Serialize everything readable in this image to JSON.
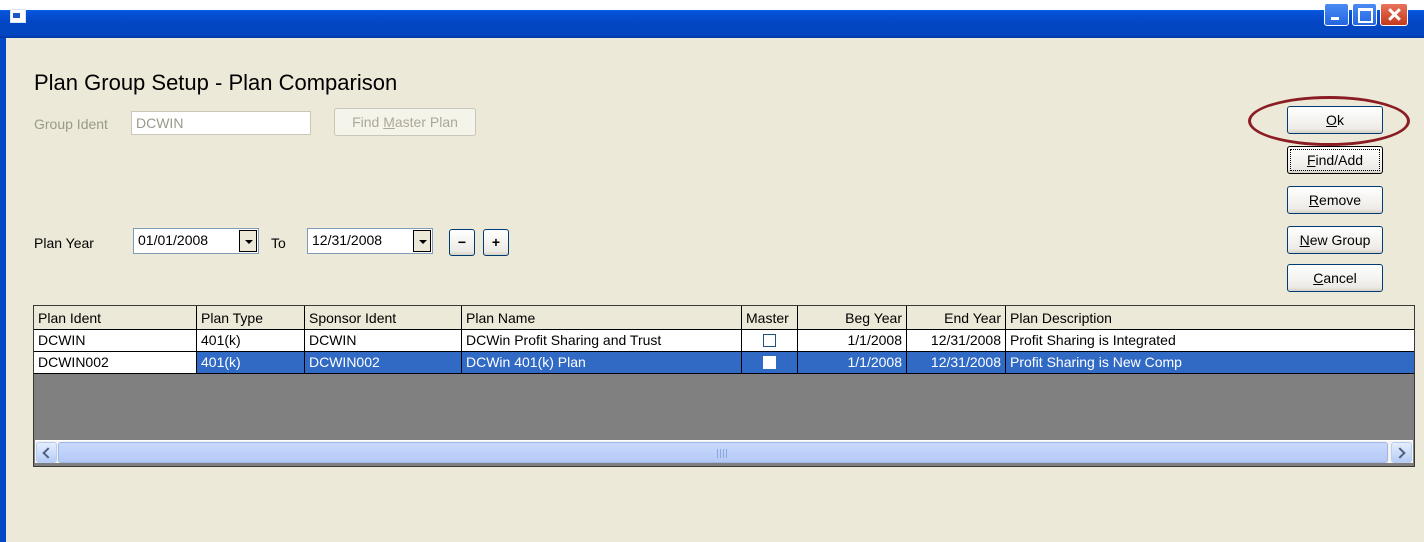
{
  "window": {
    "title": ""
  },
  "form": {
    "heading": "Plan Group Setup - Plan Comparison",
    "group_ident_label": "Group Ident",
    "group_ident_value": "DCWIN",
    "find_master_plan_prefix": "Find ",
    "find_master_plan_hot": "M",
    "find_master_plan_suffix": "aster Plan",
    "plan_year_label": "Plan Year",
    "plan_year_from": "01/01/2008",
    "to_label": "To",
    "plan_year_to": "12/31/2008",
    "minus_label": "−",
    "plus_label": "+"
  },
  "buttons": {
    "ok": {
      "hot": "O",
      "rest": "k"
    },
    "find_add": {
      "hot": "F",
      "rest": "ind/Add"
    },
    "remove": {
      "hot": "R",
      "rest": "emove"
    },
    "new_group": {
      "hot": "N",
      "rest": "ew Group"
    },
    "cancel": {
      "hot": "C",
      "rest": "ancel"
    }
  },
  "grid": {
    "columns": [
      "Plan Ident",
      "Plan Type",
      "Sponsor Ident",
      "Plan Name",
      "Master",
      "Beg Year",
      "End Year",
      "Plan Description"
    ],
    "rows": [
      {
        "plan_ident": "DCWIN",
        "plan_type": "401(k)",
        "sponsor_ident": "DCWIN",
        "plan_name": "DCWin Profit Sharing and Trust",
        "master": false,
        "beg_year": "1/1/2008",
        "end_year": "12/31/2008",
        "plan_description": "Profit Sharing is Integrated"
      },
      {
        "plan_ident": "DCWIN002",
        "plan_type": "401(k)",
        "sponsor_ident": "DCWIN002",
        "plan_name": "DCWin 401(k) Plan",
        "master": false,
        "beg_year": "1/1/2008",
        "end_year": "12/31/2008",
        "plan_description": "Profit Sharing is New Comp"
      }
    ],
    "selected_row": 1
  },
  "colors": {
    "selection": "#316ac5",
    "annotation": "#8b1c24",
    "titlebar": "#0347c5"
  }
}
